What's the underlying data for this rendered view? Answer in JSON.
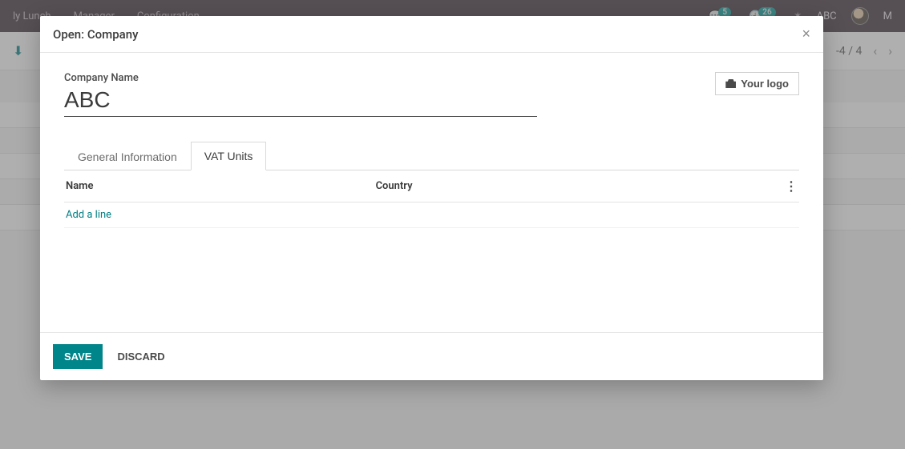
{
  "navbar": {
    "items": [
      "ly Lunch",
      "Manager",
      "Configuration"
    ],
    "msg_badge": "5",
    "activity_badge": "26",
    "company_short": "ABC",
    "user_initial": "M"
  },
  "page": {
    "pager": "-4 / 4"
  },
  "modal": {
    "title": "Open: Company",
    "company_label": "Company Name",
    "company_value": "ABC",
    "logo_button": "Your logo",
    "tabs": {
      "general": "General Information",
      "vat": "VAT Units"
    },
    "table": {
      "col_name": "Name",
      "col_country": "Country",
      "add_line": "Add a line"
    },
    "footer": {
      "save": "SAVE",
      "discard": "DISCARD"
    }
  }
}
